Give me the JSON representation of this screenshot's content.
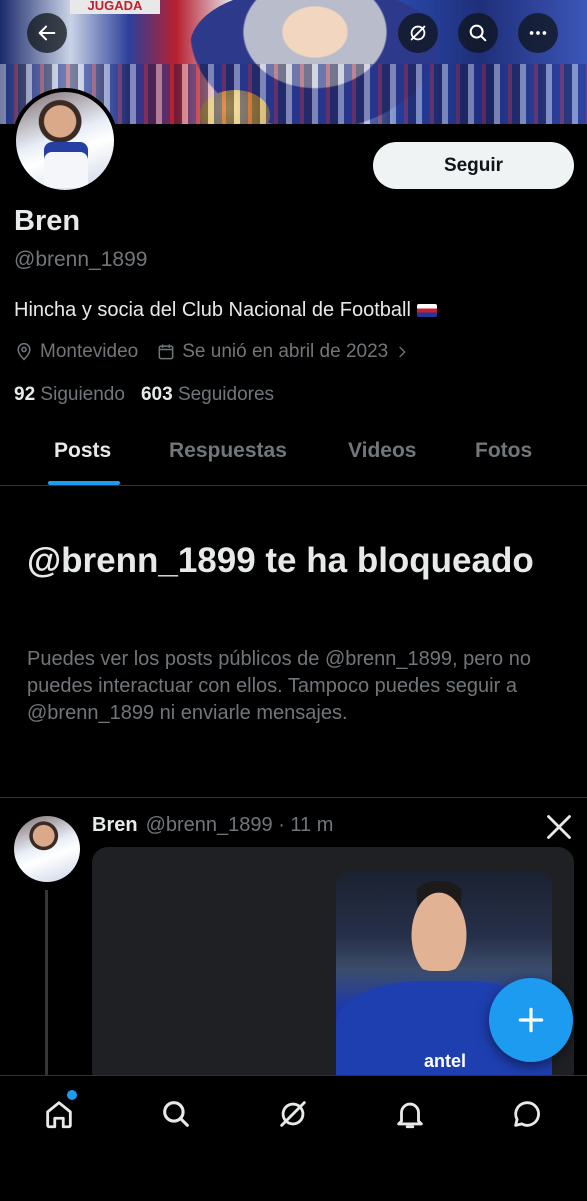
{
  "banner": {
    "tag_text": "JUGADA"
  },
  "header": {
    "back_icon": "back-arrow-icon",
    "grok_icon": "grok-icon",
    "search_icon": "search-icon",
    "more_icon": "more-icon"
  },
  "profile": {
    "follow_label": "Seguir",
    "name": "Bren",
    "handle": "@brenn_1899",
    "bio": "Hincha y socia del Club Nacional de Football",
    "location": "Montevideo",
    "joined": "Se unió en abril de 2023",
    "following_count": "92",
    "following_label": "Siguiendo",
    "followers_count": "603",
    "followers_label": "Seguidores"
  },
  "tabs": [
    {
      "label": "Posts",
      "active": true
    },
    {
      "label": "Respuestas",
      "active": false
    },
    {
      "label": "Videos",
      "active": false
    },
    {
      "label": "Fotos",
      "active": false
    }
  ],
  "blocked": {
    "title": "@brenn_1899 te ha bloqueado",
    "description": "Puedes ver los posts públicos de @brenn_1899, pero no puedes interactuar con ellos. Tampoco puedes seguir a @brenn_1899 ni enviarle mensajes."
  },
  "post": {
    "name": "Bren",
    "meta": "@brenn_1899 · 11 m",
    "card_text": "antel"
  },
  "colors": {
    "accent": "#1d9bf0",
    "text": "#e7e9ea",
    "muted": "#71767b",
    "divider": "#2f3336"
  },
  "bottom_nav": [
    "home-icon",
    "search-icon",
    "grok-icon",
    "notifications-icon",
    "messages-icon"
  ]
}
